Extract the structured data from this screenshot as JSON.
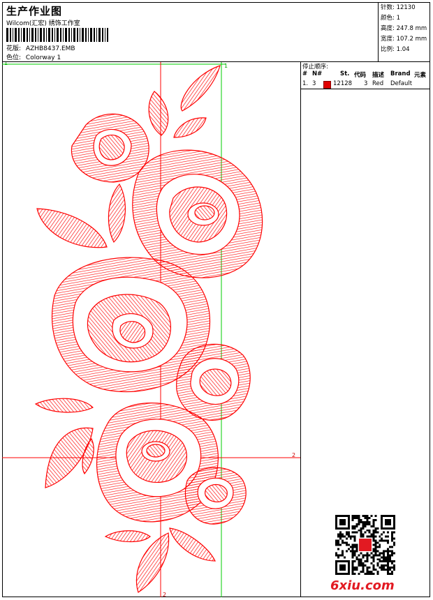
{
  "header": {
    "title": "生产作业图",
    "company": "Wilcom(汇宏) 绣饰工作室",
    "pattern_label": "花版:",
    "pattern_value": "AZHB8437.EMB",
    "colorway_label": "色位:",
    "colorway_value": "Colorway 1"
  },
  "specs": {
    "stitches_label": "针数:",
    "stitches_value": "12130",
    "colors_label": "颜色:",
    "colors_value": "1",
    "height_label": "高度:",
    "height_value": "247.8 mm",
    "width_label": "宽度:",
    "width_value": "107.2 mm",
    "scale_label": "比例:",
    "scale_value": "1.04"
  },
  "stop_sequence": {
    "title": "停止顺序:",
    "columns": [
      "#",
      "N#",
      "St.",
      "代码",
      "描述",
      "Brand",
      "元素"
    ],
    "rows": [
      {
        "index": "1.",
        "needle": "3",
        "swatch_color": "#e00000",
        "stitches": "12128",
        "code": "3",
        "desc": "Red",
        "brand": "Default",
        "element": ""
      }
    ]
  },
  "design": {
    "thread_color": "#ff0000",
    "guide_green": "#00cc00",
    "guide_red": "#ff0000",
    "marker_1_top": "1",
    "marker_1_left": "1",
    "marker_2_right": "2",
    "marker_2_bottom": "2"
  },
  "watermark": {
    "logo_text": "6xiu.com"
  }
}
